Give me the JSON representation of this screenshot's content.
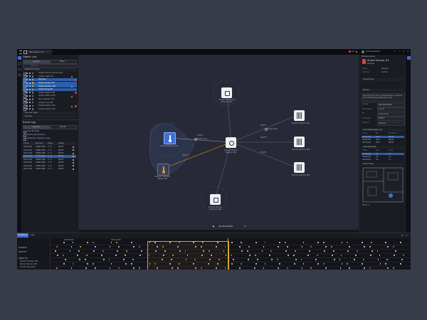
{
  "window": {
    "tab_title": "Workspace 01"
  },
  "top_right": {
    "alert_count": "12",
    "user_label": "Administrator"
  },
  "left_panel": {
    "section_title": "Object List",
    "segments": [
      "Layers",
      "Filter"
    ],
    "search_placeholder": "Search",
    "group_label": "Network Area",
    "items": [
      {
        "label": "Smart Home Camera #1",
        "selected": false
      },
      {
        "label": "Smart Light #1",
        "selected": false
      },
      {
        "label": "Hub #1",
        "selected": true
      },
      {
        "label": "Temp Sensor #1",
        "selected": true
      },
      {
        "label": "Smart Sensor #2",
        "selected": true
      },
      {
        "label": "Smart Plug #1",
        "selected": true
      },
      {
        "label": "Smart Switch #1",
        "selected": false
      },
      {
        "label": "Smart Switch #2",
        "selected": false
      },
      {
        "label": "Door Sensor #1",
        "selected": false
      },
      {
        "label": "Smart Lock #1",
        "selected": false
      },
      {
        "label": "Smart Switch #3",
        "selected": false
      },
      {
        "label": "Smart Switch #4",
        "selected": false
      }
    ],
    "footer_label": "Add Object",
    "section2_title": "Device Type",
    "section3_title": "Events",
    "event_section_title": "Event Log",
    "event_segments": [
      "Events",
      "Alerts"
    ],
    "filters": [
      "Live Events",
      "Historical Events",
      "Selected Objects Only"
    ],
    "table_headers": [
      "Time",
      "Device",
      "Type",
      "Value"
    ],
    "table_rows": [
      [
        "00:00:00",
        "TEMP SEN",
        "2 °C",
        "MQTT"
      ],
      [
        "00:01:00",
        "TEMP SEN",
        "2 °C",
        "MQTT"
      ],
      [
        "00:02:00",
        "TEMP SEN",
        "2 °C",
        "MQTT"
      ],
      [
        "00:03:00",
        "TEMP SEN",
        "2 °C",
        "MQTT"
      ],
      [
        "00:04:00",
        "TEMP SEN",
        "2 °C",
        "MQTT"
      ],
      [
        "00:05:00",
        "TEMP SEN",
        "2 °C",
        "MQTT"
      ],
      [
        "00:06:00",
        "TEMP SEN",
        "2 °C",
        "MQTT"
      ],
      [
        "00:07:00",
        "TEMP SEN",
        "2 °C",
        "MQTT"
      ]
    ]
  },
  "graph": {
    "nodes": [
      {
        "id": "camera1",
        "label": "Smart Camera Device #1",
        "kind": "camera",
        "style": "light"
      },
      {
        "id": "temp1",
        "label": "Temp Sensor #1",
        "kind": "thermometer",
        "style": "selected"
      },
      {
        "id": "hub",
        "label": "Smart Home Device #2",
        "kind": "hub",
        "style": "light"
      },
      {
        "id": "sensor2",
        "label": "Sensor Sensor Node #1",
        "kind": "thermometer",
        "style": "amber"
      },
      {
        "id": "camera2",
        "label": "Smart Home Camera #2",
        "kind": "camera",
        "style": "light"
      },
      {
        "id": "switch1",
        "label": "Smart Switch #1",
        "kind": "switch",
        "style": "light"
      },
      {
        "id": "switch2",
        "label": "Smart Switch #2",
        "kind": "switch",
        "style": "light"
      },
      {
        "id": "switch3",
        "label": "Smart Switch #3",
        "kind": "switch",
        "style": "light"
      }
    ],
    "edge_labels": [
      "MQTT",
      "MQTT",
      "MQTT",
      "MQTT",
      "MQTT"
    ],
    "edge_tag": "Data flow",
    "playback_time": "00:00:00.000"
  },
  "right_panel": {
    "title": "Smart Sensor #1",
    "subtitle": "Temperature",
    "status": "Online",
    "meta": [
      {
        "k": "Type",
        "v": "Sensor"
      },
      {
        "k": "Vendor",
        "v": "Acme"
      }
    ],
    "section_properties": "Properties",
    "section_notes": "Notes",
    "note_text": "Sensing the room's temperature in celsius and forwarding readings to hub.",
    "details": [
      {
        "k": "Serial",
        "v": "SN-0001823"
      },
      {
        "k": "Firmware",
        "v": "1.4.2"
      },
      {
        "k": "IP",
        "v": "10.0.0.12"
      },
      {
        "k": "Protocol",
        "v": "MQTT"
      },
      {
        "k": "Status",
        "v": "Online"
      }
    ],
    "section_history": "Last Messages (3)",
    "history_headers": [
      "Time",
      "Dir",
      "Protocol"
    ],
    "history_rows": [
      [
        "00:00:01",
        "OUT",
        "MQTT"
      ],
      [
        "00:00:02",
        "OUT",
        "MQTT"
      ],
      [
        "00:00:03",
        "OUT",
        "MQTT"
      ]
    ],
    "section_data": "Last Reports",
    "data_headers": [
      "Time",
      "Val",
      "Unit"
    ],
    "data_rows": [
      [
        "00:00:01",
        "22",
        "°C"
      ],
      [
        "00:00:02",
        "22",
        "°C"
      ],
      [
        "00:00:03",
        "23",
        "°C"
      ]
    ],
    "section_floor": "Floor Plan",
    "floor_label": "Floor 1"
  },
  "timeline": {
    "tabs": [
      "Timeline",
      "Logs"
    ],
    "start": "00:00:00",
    "end": "00:10:00",
    "row_labels": [
      "EVENTS",
      "DEVICE",
      "PROTOCOL"
    ],
    "objects_title": "OBJECTS",
    "object_rows": [
      "Smart Sensor #1",
      "Temp Sensor #1",
      "Smart Plug #1"
    ]
  }
}
